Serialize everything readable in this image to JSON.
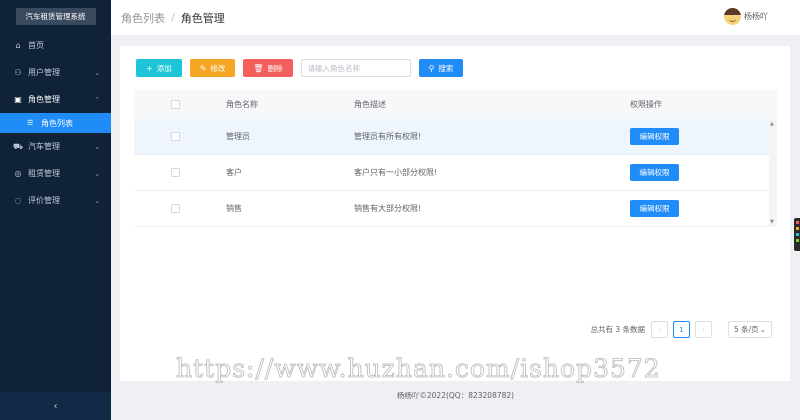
{
  "sidebar": {
    "logo": "汽车租赁管理系统",
    "items": [
      {
        "label": "首页",
        "icon": "home-icon",
        "glyph": "⌂",
        "arrow": ""
      },
      {
        "label": "用户管理",
        "icon": "users-icon",
        "glyph": "⚇",
        "arrow": "⌄"
      },
      {
        "label": "角色管理",
        "icon": "id-card-icon",
        "glyph": "▣",
        "arrow": "⌃"
      },
      {
        "label": "汽车管理",
        "icon": "car-icon",
        "glyph": "⛟",
        "arrow": "⌄"
      },
      {
        "label": "租赁管理",
        "icon": "rental-icon",
        "glyph": "◎",
        "arrow": "⌄"
      },
      {
        "label": "评价管理",
        "icon": "comment-icon",
        "glyph": "◌",
        "arrow": "⌄"
      }
    ],
    "subitem": {
      "label": "角色列表",
      "glyph": "☰"
    },
    "collapse_glyph": "‹"
  },
  "header": {
    "breadcrumb_parent": "角色列表",
    "breadcrumb_sep": "/",
    "breadcrumb_current": "角色管理",
    "username": "杨杨吖"
  },
  "toolbar": {
    "add_label": "添加",
    "edit_label": "修改",
    "delete_label": "删除",
    "search_placeholder": "请输入角色名称",
    "search_label": "搜索"
  },
  "table": {
    "columns": [
      "角色名称",
      "角色描述",
      "权限操作"
    ],
    "rows": [
      {
        "name": "管理员",
        "desc": "管理员有所有权限!",
        "action": "编辑权限"
      },
      {
        "name": "客户",
        "desc": "客户只有一小部分权限!",
        "action": "编辑权限"
      },
      {
        "name": "销售",
        "desc": "销售有大部分权限!",
        "action": "编辑权限"
      }
    ]
  },
  "pagination": {
    "total_text": "总共有 3 条数据",
    "current_page": "1",
    "page_size": "5 条/页"
  },
  "footer": "杨杨吖©2022(QQ：823208782)",
  "watermark": "https://www.huzhan.com/ishop3572",
  "colors": {
    "sidebar_bg": "#0f2238",
    "primary": "#1f8cf7",
    "add": "#1ec5d8",
    "edit": "#f5a623",
    "delete": "#f25f5c"
  }
}
